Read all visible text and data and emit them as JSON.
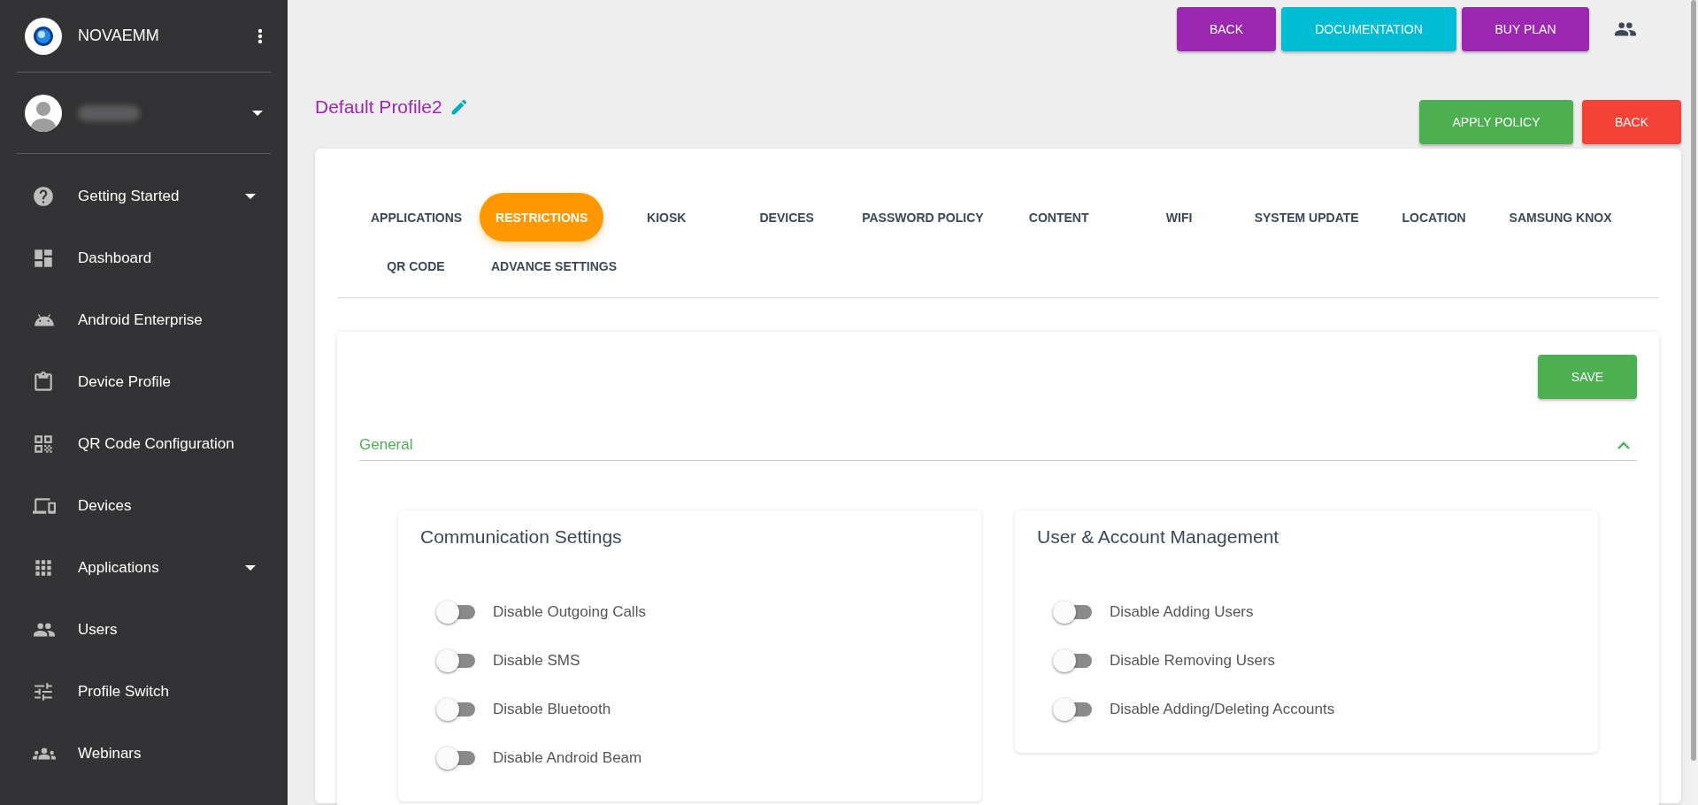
{
  "sidebar": {
    "brand": "NOVAEMM",
    "user_expandable": true,
    "items": [
      {
        "label": "Getting Started",
        "expandable": true
      },
      {
        "label": "Dashboard",
        "expandable": false
      },
      {
        "label": "Android Enterprise",
        "expandable": false
      },
      {
        "label": "Device Profile",
        "expandable": false
      },
      {
        "label": "QR Code Configuration",
        "expandable": false
      },
      {
        "label": "Devices",
        "expandable": false
      },
      {
        "label": "Applications",
        "expandable": true
      },
      {
        "label": "Users",
        "expandable": false
      },
      {
        "label": "Profile Switch",
        "expandable": false
      },
      {
        "label": "Webinars",
        "expandable": false
      }
    ]
  },
  "top_buttons": [
    {
      "label": "BACK",
      "color": "#9c27b0"
    },
    {
      "label": "DOCUMENTATION",
      "color": "#00bcd4"
    },
    {
      "label": "BUY PLAN",
      "color": "#9c27b0"
    }
  ],
  "profile": {
    "title": "Default Profile2"
  },
  "profile_buttons": [
    {
      "label": "APPLY POLICY",
      "color": "#4caf50"
    },
    {
      "label": "BACK",
      "color": "#f44336"
    }
  ],
  "tabs": [
    {
      "label": "APPLICATIONS",
      "selected": false
    },
    {
      "label": "RESTRICTIONS",
      "selected": true
    },
    {
      "label": "KIOSK",
      "selected": false
    },
    {
      "label": "DEVICES",
      "selected": false
    },
    {
      "label": "PASSWORD POLICY",
      "selected": false
    },
    {
      "label": "CONTENT",
      "selected": false
    },
    {
      "label": "WIFI",
      "selected": false
    },
    {
      "label": "SYSTEM UPDATE",
      "selected": false
    },
    {
      "label": "LOCATION",
      "selected": false
    },
    {
      "label": "SAMSUNG KNOX",
      "selected": false
    },
    {
      "label": "QR CODE",
      "selected": false
    },
    {
      "label": "ADVANCE SETTINGS",
      "selected": false
    }
  ],
  "save_button": "SAVE",
  "section": {
    "title": "General",
    "expanded": true,
    "cards": [
      {
        "title": "Communication Settings",
        "toggles": [
          {
            "label": "Disable Outgoing Calls",
            "on": false
          },
          {
            "label": "Disable SMS",
            "on": false
          },
          {
            "label": "Disable Bluetooth",
            "on": false
          },
          {
            "label": "Disable Android Beam",
            "on": false
          }
        ]
      },
      {
        "title": "User & Account Management",
        "toggles": [
          {
            "label": "Disable Adding Users",
            "on": false
          },
          {
            "label": "Disable Removing Users",
            "on": false
          },
          {
            "label": "Disable Adding/Deleting Accounts",
            "on": false
          }
        ]
      }
    ]
  }
}
